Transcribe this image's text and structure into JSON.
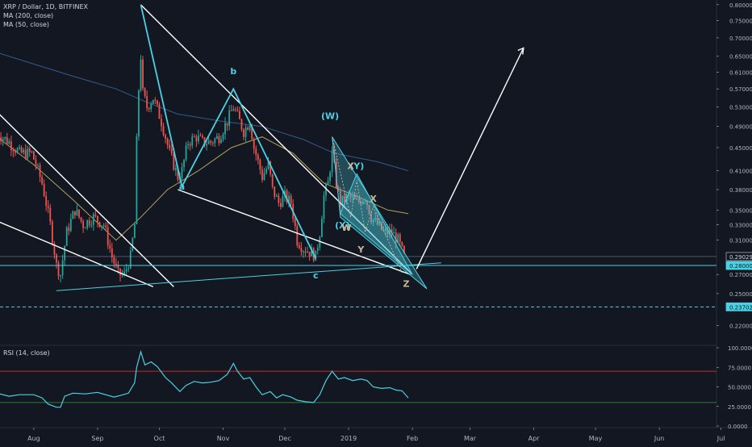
{
  "header": {
    "symbol_line": "XRP / Dollar, 1D, BITFINEX",
    "ma1_label": "MA (200, close)",
    "ma2_label": "MA (50, close)",
    "rsi_label": "RSI (14, close)"
  },
  "colors": {
    "background": "#131722",
    "bull": "#26a69a",
    "bear": "#ef5350",
    "ma200": "#2f5d8c",
    "ma50": "#b0a35a",
    "pattern": "#4dd0e1",
    "trendline": "#ffffff",
    "rsi_line": "#4dd0e1",
    "rsi_upper": "#c62828",
    "rsi_lower": "#2e7d32",
    "axis_text": "#b2b5be",
    "wave_gray": "#c7b89a"
  },
  "chart_data": {
    "type": "candlestick",
    "symbol": "XRP / Dollar",
    "timeframe": "1D",
    "exchange": "BITFINEX",
    "price_axis": {
      "ticks": [
        "0.80000",
        "0.75000",
        "0.70000",
        "0.65000",
        "0.61000",
        "0.57000",
        "0.53000",
        "0.49000",
        "0.45000",
        "0.41000",
        "0.38000",
        "0.35000",
        "0.33000",
        "0.31000",
        "0.27000",
        "0.25000",
        "0.22000"
      ],
      "ylim": [
        0.205,
        0.81
      ],
      "log_scale": true
    },
    "price_badges": [
      {
        "value": "0.29029",
        "style": "plain"
      },
      {
        "value": "0.28000",
        "style": "filled"
      },
      {
        "value": "0.23702",
        "style": "filled"
      }
    ],
    "time_axis": {
      "labels": [
        "Aug",
        "Sep",
        "Oct",
        "Nov",
        "Dec",
        "2019",
        "Feb",
        "Mar",
        "Apr",
        "May",
        "Jun",
        "Jul"
      ],
      "label_dates": [
        "2018-08-01",
        "2018-09-01",
        "2018-10-01",
        "2018-11-01",
        "2018-12-01",
        "2019-01-01",
        "2019-02-01",
        "2019-03-01",
        "2019-04-01",
        "2019-05-01",
        "2019-06-01",
        "2019-07-01"
      ]
    },
    "price_anchors": [
      [
        "2018-07-14",
        0.478
      ],
      [
        "2018-07-20",
        0.46
      ],
      [
        "2018-07-25",
        0.44
      ],
      [
        "2018-07-31",
        0.44
      ],
      [
        "2018-08-05",
        0.39
      ],
      [
        "2018-08-09",
        0.33
      ],
      [
        "2018-08-12",
        0.28
      ],
      [
        "2018-08-14",
        0.27
      ],
      [
        "2018-08-17",
        0.32
      ],
      [
        "2018-08-21",
        0.35
      ],
      [
        "2018-08-25",
        0.33
      ],
      [
        "2018-08-30",
        0.34
      ],
      [
        "2018-09-04",
        0.33
      ],
      [
        "2018-09-08",
        0.29
      ],
      [
        "2018-09-11",
        0.27
      ],
      [
        "2018-09-14",
        0.27
      ],
      [
        "2018-09-17",
        0.29
      ],
      [
        "2018-09-19",
        0.33
      ],
      [
        "2018-09-20",
        0.46
      ],
      [
        "2018-09-21",
        0.57
      ],
      [
        "2018-09-22",
        0.65
      ],
      [
        "2018-09-23",
        0.56
      ],
      [
        "2018-09-25",
        0.53
      ],
      [
        "2018-09-28",
        0.55
      ],
      [
        "2018-10-02",
        0.5
      ],
      [
        "2018-10-06",
        0.44
      ],
      [
        "2018-10-10",
        0.4
      ],
      [
        "2018-10-12",
        0.41
      ],
      [
        "2018-10-15",
        0.46
      ],
      [
        "2018-10-19",
        0.47
      ],
      [
        "2018-10-22",
        0.46
      ],
      [
        "2018-10-26",
        0.46
      ],
      [
        "2018-10-30",
        0.47
      ],
      [
        "2018-11-03",
        0.5
      ],
      [
        "2018-11-06",
        0.53
      ],
      [
        "2018-11-08",
        0.51
      ],
      [
        "2018-11-11",
        0.48
      ],
      [
        "2018-11-14",
        0.5
      ],
      [
        "2018-11-16",
        0.45
      ],
      [
        "2018-11-20",
        0.4
      ],
      [
        "2018-11-23",
        0.42
      ],
      [
        "2018-11-25",
        0.38
      ],
      [
        "2018-11-28",
        0.36
      ],
      [
        "2018-12-01",
        0.37
      ],
      [
        "2018-12-04",
        0.36
      ],
      [
        "2018-12-07",
        0.31
      ],
      [
        "2018-12-10",
        0.3
      ],
      [
        "2018-12-14",
        0.295
      ],
      [
        "2018-12-16",
        0.29
      ],
      [
        "2018-12-18",
        0.32
      ],
      [
        "2018-12-20",
        0.37
      ],
      [
        "2018-12-22",
        0.39
      ],
      [
        "2018-12-24",
        0.44
      ],
      [
        "2018-12-26",
        0.39
      ],
      [
        "2018-12-28",
        0.36
      ],
      [
        "2019-01-01",
        0.37
      ],
      [
        "2019-01-05",
        0.36
      ],
      [
        "2019-01-09",
        0.37
      ],
      [
        "2019-01-12",
        0.34
      ],
      [
        "2019-01-15",
        0.33
      ],
      [
        "2019-01-18",
        0.32
      ],
      [
        "2019-01-22",
        0.32
      ],
      [
        "2019-01-25",
        0.31
      ],
      [
        "2019-01-28",
        0.29
      ]
    ],
    "moving_averages": [
      {
        "name": "MA (200, close)",
        "points": [
          [
            "2018-07-14",
            0.66
          ],
          [
            "2018-08-01",
            0.63
          ],
          [
            "2018-08-20",
            0.6
          ],
          [
            "2018-09-10",
            0.57
          ],
          [
            "2018-09-25",
            0.54
          ],
          [
            "2018-10-10",
            0.515
          ],
          [
            "2018-11-01",
            0.5
          ],
          [
            "2018-11-20",
            0.49
          ],
          [
            "2018-12-10",
            0.465
          ],
          [
            "2018-12-25",
            0.44
          ],
          [
            "2019-01-15",
            0.425
          ],
          [
            "2019-01-30",
            0.41
          ]
        ]
      },
      {
        "name": "MA (50, close)",
        "points": [
          [
            "2018-07-14",
            0.47
          ],
          [
            "2018-08-01",
            0.42
          ],
          [
            "2018-08-20",
            0.365
          ],
          [
            "2018-09-10",
            0.31
          ],
          [
            "2018-09-22",
            0.34
          ],
          [
            "2018-10-05",
            0.38
          ],
          [
            "2018-10-20",
            0.41
          ],
          [
            "2018-11-05",
            0.45
          ],
          [
            "2018-11-20",
            0.47
          ],
          [
            "2018-12-05",
            0.44
          ],
          [
            "2018-12-20",
            0.39
          ],
          [
            "2019-01-05",
            0.37
          ],
          [
            "2019-01-20",
            0.35
          ],
          [
            "2019-01-30",
            0.345
          ]
        ]
      }
    ],
    "rsi": {
      "name": "RSI (14, close)",
      "ticks": [
        "100.0000",
        "75.0000",
        "50.0000",
        "25.0000",
        "0.0000"
      ],
      "ylim": [
        0,
        100
      ],
      "upper_band": 70,
      "lower_band": 30,
      "points": [
        [
          "2018-07-14",
          42
        ],
        [
          "2018-07-20",
          38
        ],
        [
          "2018-07-25",
          40
        ],
        [
          "2018-08-01",
          40
        ],
        [
          "2018-08-05",
          36
        ],
        [
          "2018-08-08",
          28
        ],
        [
          "2018-08-12",
          24
        ],
        [
          "2018-08-14",
          24
        ],
        [
          "2018-08-16",
          38
        ],
        [
          "2018-08-20",
          42
        ],
        [
          "2018-08-26",
          41
        ],
        [
          "2018-09-01",
          43
        ],
        [
          "2018-09-05",
          40
        ],
        [
          "2018-09-09",
          37
        ],
        [
          "2018-09-12",
          39
        ],
        [
          "2018-09-16",
          42
        ],
        [
          "2018-09-19",
          55
        ],
        [
          "2018-09-20",
          75
        ],
        [
          "2018-09-22",
          95
        ],
        [
          "2018-09-24",
          78
        ],
        [
          "2018-09-27",
          82
        ],
        [
          "2018-09-30",
          76
        ],
        [
          "2018-10-04",
          62
        ],
        [
          "2018-10-07",
          55
        ],
        [
          "2018-10-11",
          44
        ],
        [
          "2018-10-14",
          52
        ],
        [
          "2018-10-18",
          57
        ],
        [
          "2018-10-22",
          55
        ],
        [
          "2018-10-26",
          56
        ],
        [
          "2018-10-30",
          58
        ],
        [
          "2018-11-03",
          66
        ],
        [
          "2018-11-06",
          80
        ],
        [
          "2018-11-08",
          70
        ],
        [
          "2018-11-11",
          60
        ],
        [
          "2018-11-14",
          62
        ],
        [
          "2018-11-17",
          50
        ],
        [
          "2018-11-20",
          40
        ],
        [
          "2018-11-24",
          44
        ],
        [
          "2018-11-27",
          36
        ],
        [
          "2018-11-30",
          40
        ],
        [
          "2018-12-04",
          37
        ],
        [
          "2018-12-07",
          33
        ],
        [
          "2018-12-11",
          31
        ],
        [
          "2018-12-15",
          30
        ],
        [
          "2018-12-18",
          40
        ],
        [
          "2018-12-21",
          58
        ],
        [
          "2018-12-24",
          70
        ],
        [
          "2018-12-27",
          60
        ],
        [
          "2018-12-30",
          62
        ],
        [
          "2019-01-03",
          58
        ],
        [
          "2019-01-07",
          60
        ],
        [
          "2019-01-10",
          58
        ],
        [
          "2019-01-13",
          50
        ],
        [
          "2019-01-17",
          48
        ],
        [
          "2019-01-21",
          49
        ],
        [
          "2019-01-24",
          46
        ],
        [
          "2019-01-27",
          45
        ],
        [
          "2019-01-30",
          36
        ]
      ]
    },
    "wave_labels": [
      {
        "text": "a",
        "date": "2018-10-12",
        "price": 0.38,
        "color": "pattern"
      },
      {
        "text": "b",
        "date": "2018-11-06",
        "price": 0.605,
        "color": "pattern"
      },
      {
        "text": "c",
        "date": "2018-12-16",
        "price": 0.266,
        "color": "pattern"
      },
      {
        "text": "(W)",
        "date": "2018-12-23",
        "price": 0.505,
        "color": "pattern"
      },
      {
        "text": "(X)",
        "date": "2018-12-29",
        "price": 0.325,
        "color": "pattern"
      },
      {
        "text": "(Y)",
        "date": "2019-01-05",
        "price": 0.413,
        "color": "pattern"
      },
      {
        "text": "W",
        "date": "2018-12-31",
        "price": 0.322,
        "color": "wave_gray"
      },
      {
        "text": "X",
        "date": "2019-01-02",
        "price": 0.413,
        "color": "wave_gray"
      },
      {
        "text": "X",
        "date": "2019-01-13",
        "price": 0.362,
        "color": "wave_gray"
      },
      {
        "text": "Y",
        "date": "2019-01-07",
        "price": 0.295,
        "color": "wave_gray"
      },
      {
        "text": "Z",
        "date": "2019-01-29",
        "price": 0.257,
        "color": "wave_gray"
      }
    ],
    "grid": false,
    "legend_position": "top-left"
  }
}
